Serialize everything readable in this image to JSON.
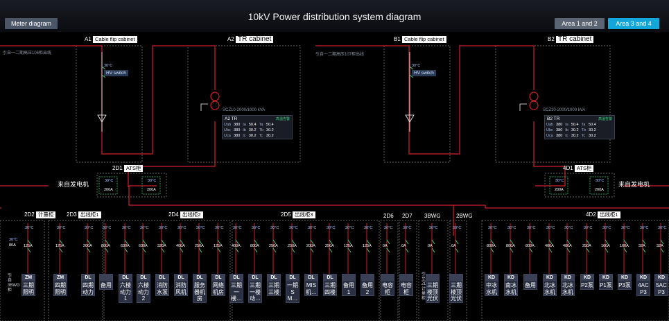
{
  "header": {
    "title": "10kV Power distribution system diagram",
    "meter_button": "Meter diagram",
    "area12_button": "Area 1 and 2",
    "area34_button": "Area  3 and 4"
  },
  "cabinets": {
    "a1": {
      "code": "A1",
      "name": "Cable flip cabinet"
    },
    "a2": {
      "code": "A2",
      "name": "TR cabinet"
    },
    "b1": {
      "code": "B1",
      "name": "Cable flip cabinet"
    },
    "b2": {
      "code": "B2",
      "name": "TR cabinet"
    }
  },
  "notes": {
    "left_source": "引自一二期高压105柜出线",
    "right_source": "引自一二期高压107柜出线",
    "hv_switch": "HV switch",
    "hv_temp": "30°C",
    "transformer_model": "SCZ10-2000/1000 kVA",
    "generator": "来自发电机"
  },
  "tr_a2": {
    "title": "A2 TR",
    "status": "高温告警",
    "rows": [
      [
        "Uab",
        "380",
        "Ia",
        "50.4",
        "Ta",
        "50.4"
      ],
      [
        "Ubc",
        "380",
        "Ib",
        "30.2",
        "Tb",
        "30.2"
      ],
      [
        "Uca",
        "380",
        "Ic",
        "30.2",
        "Tc",
        "30.2"
      ]
    ]
  },
  "tr_b2": {
    "title": "B2 TR",
    "status": "高温告警",
    "rows": [
      [
        "Uab",
        "380",
        "Ia",
        "50.4",
        "Ta",
        "50.4"
      ],
      [
        "Ubc",
        "380",
        "Ib",
        "30.2",
        "Tb",
        "30.2"
      ],
      [
        "Uca",
        "380",
        "Ic",
        "30.2",
        "Tc",
        "30.2"
      ]
    ]
  },
  "ats": {
    "left": {
      "code": "2D1",
      "name": "ATS柜"
    },
    "right": {
      "code": "4D1",
      "name": "ATS柜"
    },
    "temp": "30°C",
    "amp": "200A"
  },
  "sections": {
    "s2d2": {
      "code": "2D2",
      "name": "计量柜"
    },
    "s2d3": {
      "code": "2D3",
      "name": "出线柜1"
    },
    "s2d4": {
      "code": "2D4",
      "name": "出线柜2"
    },
    "s2d5": {
      "code": "2D5",
      "name": "出线柜3"
    },
    "s2d6": {
      "code": "2D6"
    },
    "s2d7": {
      "code": "2D7"
    },
    "s3bwg": {
      "code": "3BWG"
    },
    "s2bwg": {
      "code": "2BWG"
    },
    "s4d2": {
      "code": "4D2",
      "name": "出线柜1"
    }
  },
  "left_vert_note": "引自3BWG柜",
  "mid_vert_note": "引至ZD计量柜",
  "left_temp": "30°C",
  "left_amp": "80A",
  "feeders": [
    {
      "code": "ZM",
      "name": "三期照明",
      "temp": "30°C",
      "amp": "125A"
    },
    {
      "code": "ZM",
      "name": "四期照明",
      "temp": "30°C",
      "amp": "125A"
    },
    {
      "code": "DL",
      "name": "四期动力",
      "temp": "30°C",
      "amp": "200A"
    },
    {
      "code": "",
      "name": "备用",
      "temp": "30°C",
      "amp": "800A"
    },
    {
      "code": "DL",
      "name": "六楼动力1",
      "temp": "30°C",
      "amp": "630A"
    },
    {
      "code": "DL",
      "name": "六楼动力2",
      "temp": "30°C",
      "amp": "630A"
    },
    {
      "code": "DL",
      "name": "消防水泵",
      "temp": "30°C",
      "amp": "320A"
    },
    {
      "code": "DL",
      "name": "消防风机",
      "temp": "30°C",
      "amp": "400A"
    },
    {
      "code": "DL",
      "name": "服务器机房",
      "temp": "30°C",
      "amp": "250A"
    },
    {
      "code": "DL",
      "name": "网络机房",
      "temp": "30°C",
      "amp": "125A"
    },
    {
      "code": "DL",
      "name": "三期一楼…",
      "temp": "30°C",
      "amp": "400A"
    },
    {
      "code": "DL",
      "name": "三期一楼动…",
      "temp": "30°C",
      "amp": "800A"
    },
    {
      "code": "DL",
      "name": "三期三楼",
      "temp": "30°C",
      "amp": "250A"
    },
    {
      "code": "DL",
      "name": "一期SM…",
      "temp": "30°C",
      "amp": "250A"
    },
    {
      "code": "DL",
      "name": "MIS机…",
      "temp": "30°C",
      "amp": "200A"
    },
    {
      "code": "DL",
      "name": "三期四楼",
      "temp": "30°C",
      "amp": "250A"
    },
    {
      "code": "",
      "name": "备用1",
      "temp": "30°C",
      "amp": "125A"
    },
    {
      "code": "",
      "name": "备用2",
      "temp": "30°C",
      "amp": "125A"
    },
    {
      "code": "",
      "name": "电容柜",
      "temp": "30°C",
      "amp": "0A"
    },
    {
      "code": "",
      "name": "电容柜",
      "temp": "30°C",
      "amp": "0A"
    },
    {
      "code": "",
      "name": "三期楼顶光伏",
      "temp": "30°C",
      "amp": "0A"
    },
    {
      "code": "",
      "name": "三期楼顶光伏",
      "temp": "30°C",
      "amp": "0A"
    },
    {
      "code": "KD",
      "name": "中冰水机",
      "temp": "30°C",
      "amp": "800A"
    },
    {
      "code": "KD",
      "name": "南冰水机",
      "temp": "30°C",
      "amp": "800A"
    },
    {
      "code": "",
      "name": "备用",
      "temp": "30°C",
      "amp": "800A"
    },
    {
      "code": "KD",
      "name": "北冰水机",
      "temp": "30°C",
      "amp": "400A"
    },
    {
      "code": "KD",
      "name": "北冰水机",
      "temp": "30°C",
      "amp": "400A"
    },
    {
      "code": "KD",
      "name": "P2泵",
      "temp": "30°C",
      "amp": "250A"
    },
    {
      "code": "KD",
      "name": "P1泵",
      "temp": "30°C",
      "amp": "160A"
    },
    {
      "code": "KD",
      "name": "P3泵",
      "temp": "30°C",
      "amp": "160A"
    },
    {
      "code": "KD",
      "name": "4ACP3",
      "temp": "30°C",
      "amp": "32A"
    },
    {
      "code": "KD",
      "name": "5ACP3",
      "temp": "30°C",
      "amp": "32A"
    }
  ]
}
